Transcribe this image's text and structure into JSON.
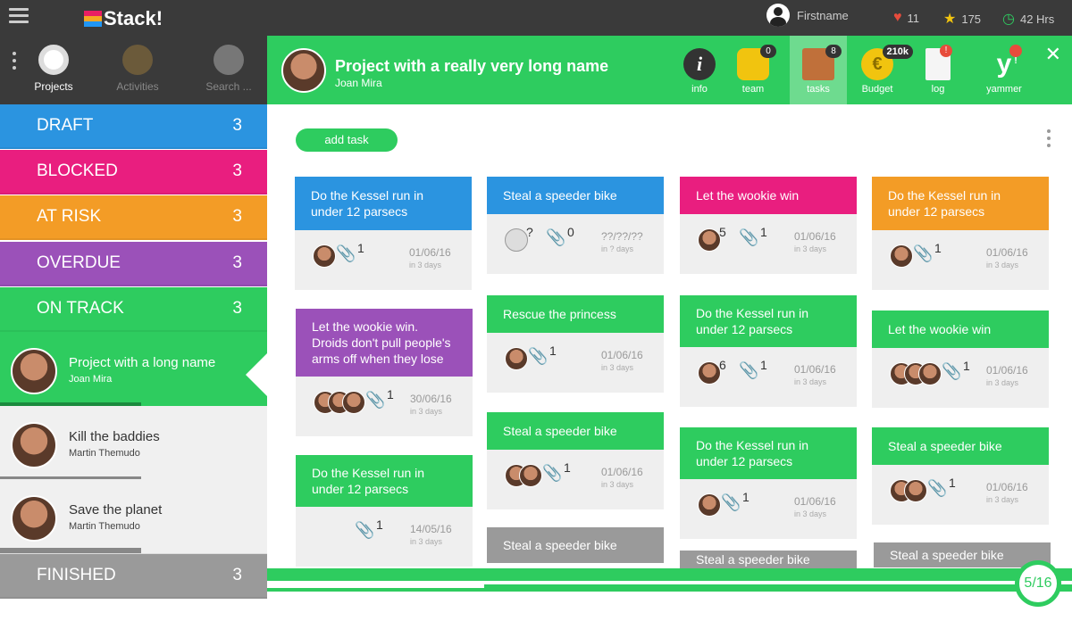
{
  "app": {
    "name": "Stack!"
  },
  "user": {
    "name": "Firstname",
    "hearts": "11",
    "stars": "175",
    "hours": "42 Hrs"
  },
  "tools": [
    {
      "label": "Projects"
    },
    {
      "label": "Activities"
    },
    {
      "label": "Search ..."
    }
  ],
  "categories": [
    {
      "label": "DRAFT",
      "count": "3",
      "color": "#2b94e0"
    },
    {
      "label": "BLOCKED",
      "count": "3",
      "color": "#e91e7f"
    },
    {
      "label": "AT RISK",
      "count": "3",
      "color": "#f39c26"
    },
    {
      "label": "OVERDUE",
      "count": "3",
      "color": "#9b51b9"
    },
    {
      "label": "ON TRACK",
      "count": "3",
      "color": "#2ecc5f"
    },
    {
      "label": "FINISHED",
      "count": "3",
      "color": "#9a9a9a"
    }
  ],
  "projects": [
    {
      "name": "Project with a long name",
      "owner": "Joan Mira",
      "progress": 0.53
    },
    {
      "name": "Kill the baddies",
      "owner": "Martin Themudo",
      "progress": 0.53
    },
    {
      "name": "Save the planet",
      "owner": "Martin Themudo",
      "progress": 0.53
    }
  ],
  "header": {
    "title": "Project with a really very long name",
    "owner": "Joan Mira",
    "tabs": [
      {
        "label": "info",
        "badge": ""
      },
      {
        "label": "team",
        "badge": "0"
      },
      {
        "label": "tasks",
        "badge": "8"
      },
      {
        "label": "Budget",
        "badge": "210k"
      },
      {
        "label": "log",
        "badge": "!"
      },
      {
        "label": "yammer",
        "badge": "!"
      }
    ]
  },
  "board": {
    "add_task": "add task",
    "page": "5/16",
    "progress": 0.27,
    "cards": [
      {
        "title": "Do the Kessel run in under 12 parsecs",
        "avatars": 1,
        "count": "",
        "clips": "1",
        "date": "01/06/16",
        "days": "in 3 days",
        "color": "#2b94e0"
      },
      {
        "title": "Let the wookie win. Droids don't pull people's arms off when they lose",
        "avatars": 3,
        "count": "",
        "clips": "1",
        "date": "30/06/16",
        "days": "in 3 days",
        "color": "#9b51b9"
      },
      {
        "title": "Do the Kessel run in under 12 parsecs",
        "avatars": 0,
        "count": "",
        "clips": "1",
        "date": "14/05/16",
        "days": "in 3 days",
        "color": "#2ecc5f"
      },
      {
        "title": "Steal a speeder bike",
        "avatars": -1,
        "count": "?",
        "clips": "0",
        "date": "??/??/??",
        "days": "in ? days",
        "color": "#2b94e0"
      },
      {
        "title": "Rescue the princess",
        "avatars": 1,
        "count": "",
        "clips": "1",
        "date": "01/06/16",
        "days": "in 3 days",
        "color": "#2ecc5f"
      },
      {
        "title": "Steal a speeder bike",
        "avatars": 2,
        "count": "",
        "clips": "1",
        "date": "01/06/16",
        "days": "in 3 days",
        "color": "#2ecc5f"
      },
      {
        "title": "Steal a speeder bike",
        "color": "#9a9a9a"
      },
      {
        "title": "Let the wookie win",
        "avatars": 1,
        "count": "5",
        "clips": "1",
        "date": "01/06/16",
        "days": "in 3 days",
        "color": "#e91e7f"
      },
      {
        "title": "Do the Kessel run in under 12 parsecs",
        "avatars": 1,
        "count": "6",
        "clips": "1",
        "date": "01/06/16",
        "days": "in 3 days",
        "color": "#2ecc5f"
      },
      {
        "title": "Do the Kessel run in under 12 parsecs",
        "avatars": 1,
        "count": "",
        "clips": "1",
        "date": "01/06/16",
        "days": "in 3 days",
        "color": "#2ecc5f"
      },
      {
        "title": "Steal a speeder bike",
        "color": "#9a9a9a"
      },
      {
        "title": "Do the Kessel run in under 12 parsecs",
        "avatars": 1,
        "count": "",
        "clips": "1",
        "date": "01/06/16",
        "days": "in 3 days",
        "color": "#f39c26"
      },
      {
        "title": "Let the wookie win",
        "avatars": 3,
        "count": "",
        "clips": "1",
        "date": "01/06/16",
        "days": "in 3 days",
        "color": "#2ecc5f"
      },
      {
        "title": "Steal a speeder bike",
        "avatars": 2,
        "count": "",
        "clips": "1",
        "date": "01/06/16",
        "days": "in 3 days",
        "color": "#2ecc5f"
      },
      {
        "title": "Steal a speeder bike",
        "color": "#9a9a9a"
      }
    ]
  }
}
